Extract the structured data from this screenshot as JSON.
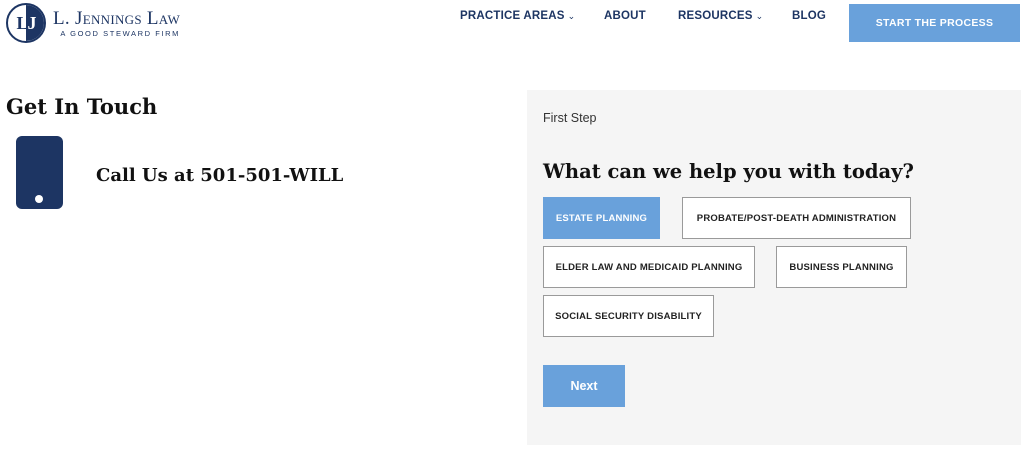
{
  "header": {
    "logo": {
      "initials_left": "L",
      "initials_right": "J",
      "name": "L. Jennings Law",
      "tagline": "A GOOD STEWARD FIRM"
    },
    "nav": [
      {
        "label": "PRACTICE AREAS",
        "has_dropdown": true
      },
      {
        "label": "ABOUT",
        "has_dropdown": false
      },
      {
        "label": "RESOURCES",
        "has_dropdown": true
      },
      {
        "label": "BLOG",
        "has_dropdown": false
      }
    ],
    "cta_label": "START THE PROCESS"
  },
  "contact": {
    "title": "Get In Touch",
    "call_text": "Call Us at 501-501-WILL",
    "icon": "phone-icon"
  },
  "form": {
    "step_label": "First Step",
    "question": "What can we help you with today?",
    "options": [
      {
        "label": "ESTATE PLANNING",
        "selected": true
      },
      {
        "label": "PROBATE/POST-DEATH ADMINISTRATION",
        "selected": false
      },
      {
        "label": "ELDER LAW AND MEDICAID PLANNING",
        "selected": false
      },
      {
        "label": "BUSINESS PLANNING",
        "selected": false
      },
      {
        "label": "SOCIAL SECURITY DISABILITY",
        "selected": false
      }
    ],
    "next_label": "Next"
  },
  "colors": {
    "brand_navy": "#1d3563",
    "accent_blue": "#69a1db",
    "panel_bg": "#f5f5f5"
  }
}
